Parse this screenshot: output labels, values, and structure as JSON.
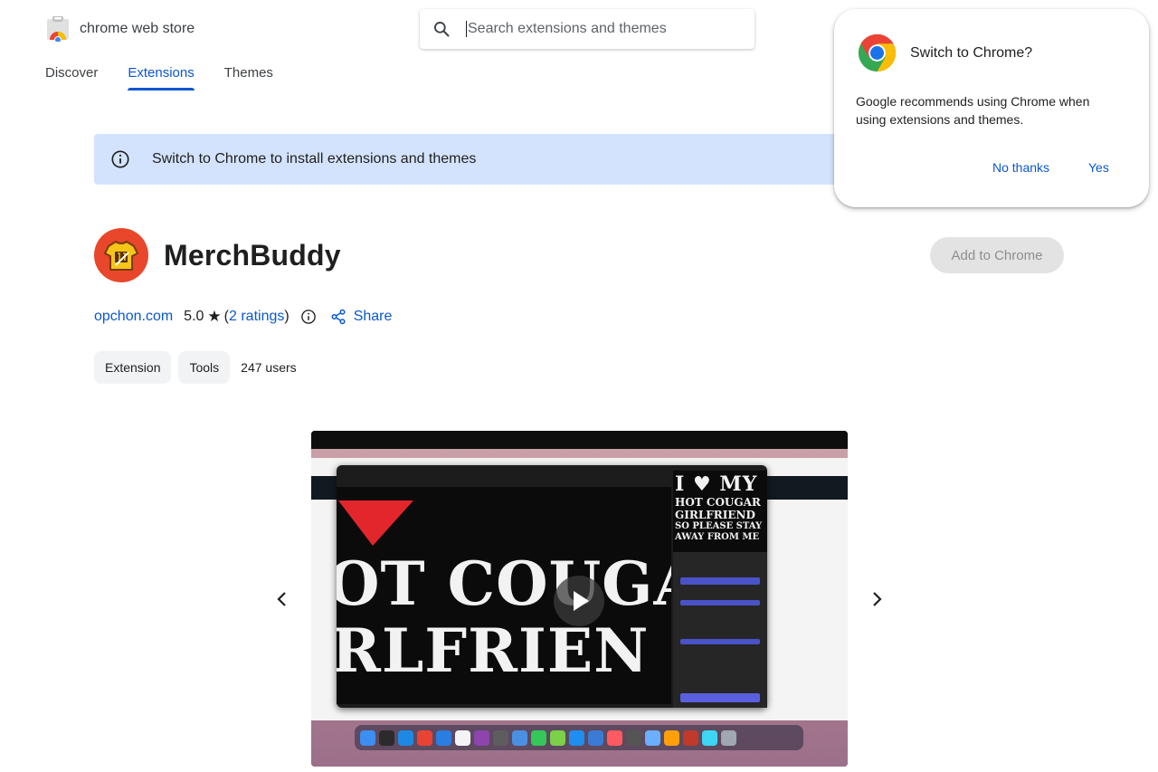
{
  "store": {
    "name": "chrome web store"
  },
  "search": {
    "placeholder": "Search extensions and themes"
  },
  "nav": {
    "items": [
      "Discover",
      "Extensions",
      "Themes"
    ],
    "active": "Extensions"
  },
  "banner": {
    "text": "Switch to Chrome to install extensions and themes"
  },
  "popup": {
    "title": "Switch to Chrome?",
    "body": "Google recommends using Chrome when using extensions and themes.",
    "no_label": "No thanks",
    "yes_label": "Yes"
  },
  "extension": {
    "name": "MerchBuddy",
    "add_label": "Add to Chrome",
    "publisher": "opchon.com",
    "rating": "5.0",
    "rating_open": "(",
    "ratings_link": "2 ratings",
    "rating_close": ")",
    "share_label": "Share",
    "chips": [
      "Extension",
      "Tools"
    ],
    "users": "247 users"
  },
  "video": {
    "lines": [
      "I ♥ MY",
      "HOT COUGAR",
      "GIRLFRIEND",
      "SO PLEASE STAY",
      "AWAY FROM ME"
    ],
    "canvas_lines": [
      "OT COUGA",
      "RLFRIEN"
    ]
  },
  "colors": {
    "accent": "#0b57d0",
    "banner_bg": "#d3e3fd",
    "app_icon_bg": "#e8472b"
  },
  "icons": {
    "search": "search-icon",
    "info": "info-icon",
    "share": "share-icon",
    "prev": "chevron-left-icon",
    "next": "chevron-right-icon",
    "play": "play-icon"
  }
}
